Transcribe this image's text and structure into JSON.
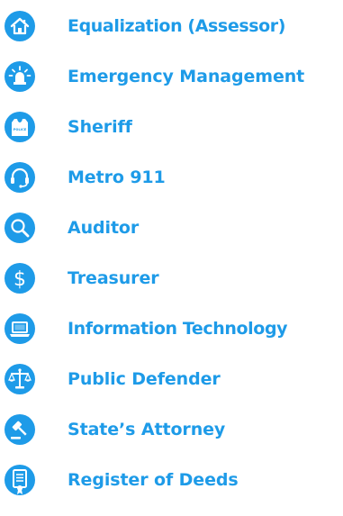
{
  "theme": {
    "icon_color": "#1e9be8",
    "text_color": "#1e9be8"
  },
  "departments": [
    {
      "label": "Equalization (Assessor)",
      "icon": "house-icon"
    },
    {
      "label": "Emergency Management",
      "icon": "siren-icon"
    },
    {
      "label": "Sheriff",
      "icon": "police-vest-icon"
    },
    {
      "label": "Metro 911",
      "icon": "headset-icon"
    },
    {
      "label": "Auditor",
      "icon": "magnifying-glass-icon"
    },
    {
      "label": "Treasurer",
      "icon": "dollar-sign-icon"
    },
    {
      "label": "Information Technology",
      "icon": "laptop-icon"
    },
    {
      "label": "Public Defender",
      "icon": "scales-icon"
    },
    {
      "label": "State’s Attorney",
      "icon": "gavel-icon"
    },
    {
      "label": "Register of Deeds",
      "icon": "document-icon"
    }
  ],
  "icon_text": {
    "police_vest": "POLICE"
  }
}
